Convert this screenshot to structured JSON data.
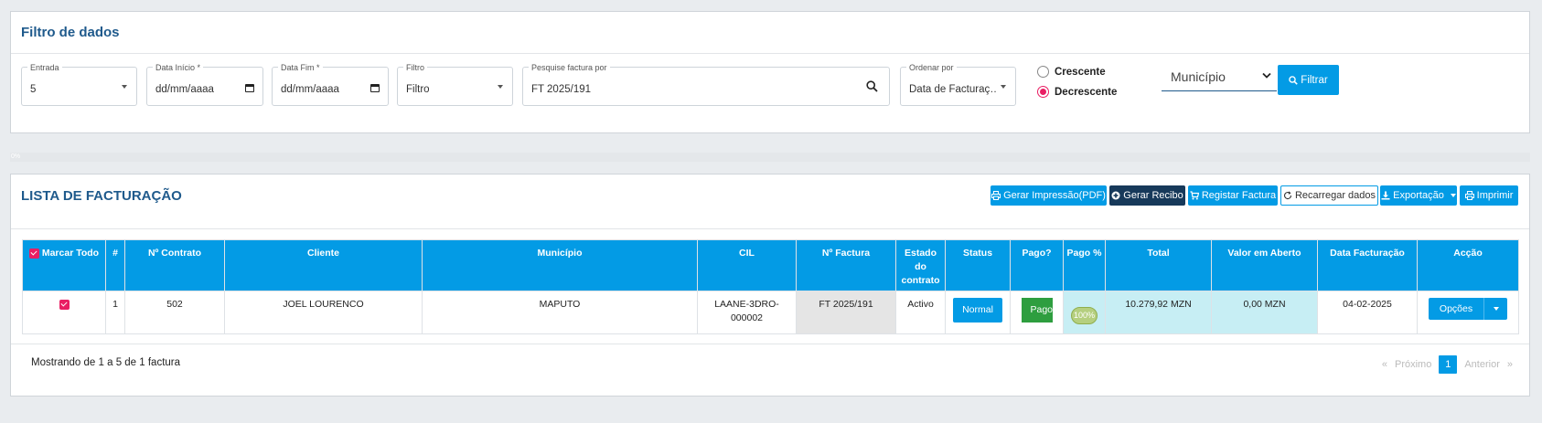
{
  "filter": {
    "title": "Filtro de dados",
    "entrada": {
      "label": "Entrada",
      "value": "5"
    },
    "data_inicio": {
      "label": "Data Início *",
      "value": "dd/mm/aaaa"
    },
    "data_fim": {
      "label": "Data Fim *",
      "value": "dd/mm/aaaa"
    },
    "filtro": {
      "label": "Filtro",
      "value": "Filtro"
    },
    "pesquisa": {
      "label": "Pesquise factura por",
      "value": "FT 2025/191"
    },
    "ordenar": {
      "label": "Ordenar por",
      "value": "Data de Facturaç…"
    },
    "crescente": "Crescente",
    "decrescente": "Decrescente",
    "municipio": "Município",
    "filtrar_btn": "Filtrar"
  },
  "progress_label": "0%",
  "list": {
    "title": "LISTA DE FACTURAÇÃO",
    "actions": {
      "gerar_impressao": "Gerar Impressão(PDF)",
      "gerar_recibo": "Gerar Recibo",
      "registar_factura": "Registar Factura",
      "recarregar": "Recarregar dados",
      "exportacao": "Exportação",
      "imprimir": "Imprimir"
    },
    "columns": {
      "marcar_todo": "Marcar Todo",
      "num": "#",
      "contrato": "Nº Contrato",
      "cliente": "Cliente",
      "municipio": "Município",
      "cil": "CIL",
      "factura": "Nº Factura",
      "estado": "Estado do contrato",
      "status": "Status",
      "pago": "Pago?",
      "pago_pct": "Pago %",
      "total": "Total",
      "aberto": "Valor em Aberto",
      "data": "Data Facturação",
      "accao": "Acção"
    },
    "rows": [
      {
        "num": "1",
        "contrato": "502",
        "cliente": "JOEL LOURENCO",
        "municipio": "MAPUTO",
        "cil": "LAANE-3DRO-000002",
        "factura": "FT 2025/191",
        "estado": "Activo",
        "status": "Normal",
        "pago": "Pago",
        "pago_pct": "100%",
        "total": "10.279,92 MZN",
        "aberto": "0,00 MZN",
        "data": "04-02-2025",
        "accao": "Opções"
      }
    ],
    "footer": {
      "showing": "Mostrando de 1 a 5 de 1 factura",
      "prev": "Próximo",
      "page": "1",
      "next": "Anterior",
      "first_arrow": "«",
      "last_arrow": "»"
    }
  },
  "colors": {
    "primary": "#039be5",
    "dark": "#17395a",
    "accent": "#e91e63",
    "success": "#2e9e3f",
    "title": "#1f5a8c"
  }
}
